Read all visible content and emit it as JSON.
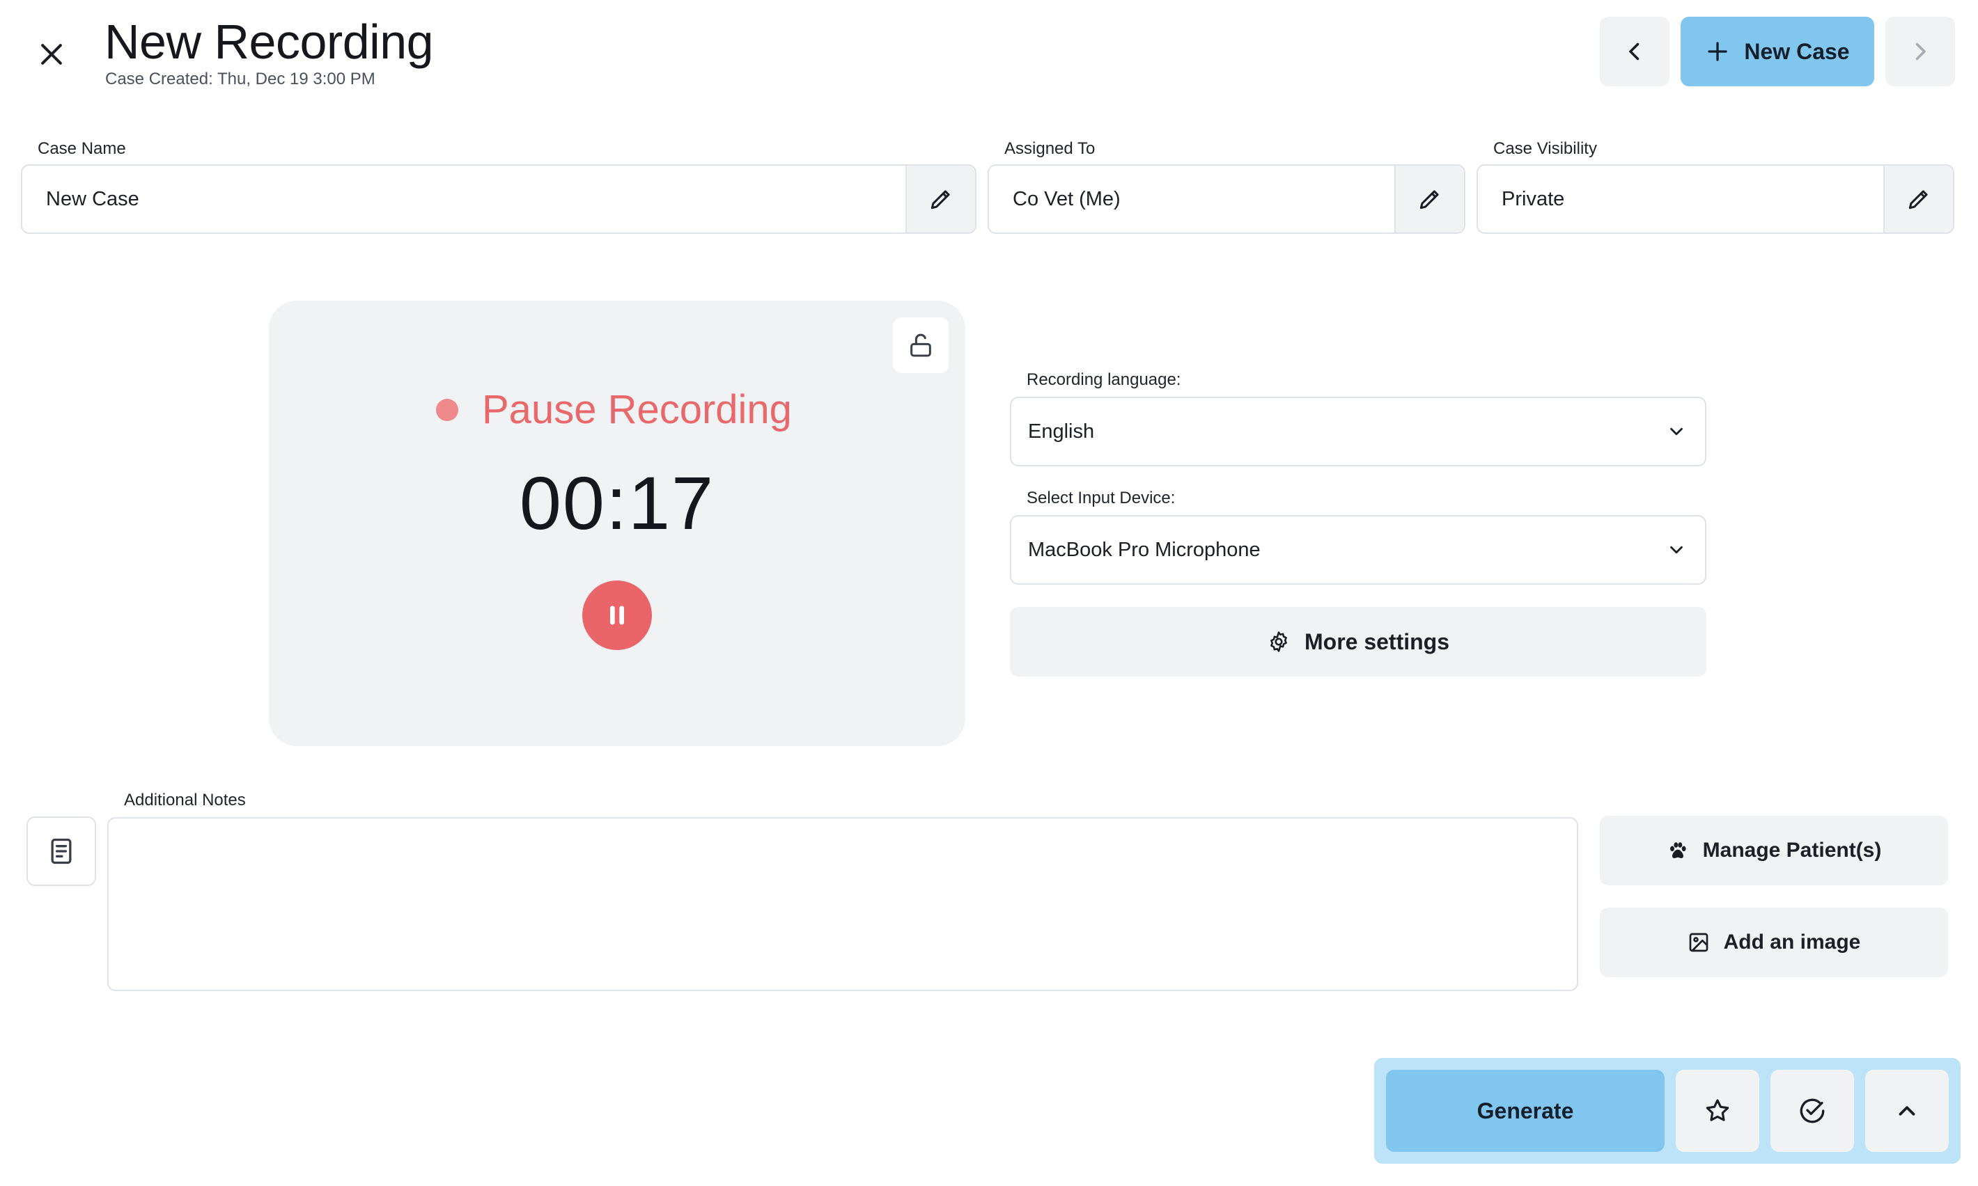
{
  "header": {
    "title": "New Recording",
    "subtitle": "Case Created: Thu, Dec 19 3:00 PM",
    "new_case_label": "New Case"
  },
  "fields": {
    "case_name": {
      "label": "Case Name",
      "value": "New Case"
    },
    "assigned_to": {
      "label": "Assigned To",
      "value": "Co Vet (Me)"
    },
    "visibility": {
      "label": "Case Visibility",
      "value": "Private"
    }
  },
  "recorder": {
    "status_label": "Pause Recording",
    "timer": "00:17",
    "status_color": "#e8686c"
  },
  "settings": {
    "language_label": "Recording language:",
    "language_value": "English",
    "device_label": "Select Input Device:",
    "device_value": "MacBook Pro Microphone",
    "more_settings_label": "More settings"
  },
  "notes": {
    "label": "Additional Notes",
    "value": ""
  },
  "side_actions": {
    "manage_patients_label": "Manage Patient(s)",
    "add_image_label": "Add an image"
  },
  "action_bar": {
    "generate_label": "Generate"
  },
  "colors": {
    "accent": "#80c6ef",
    "accent_bar": "#bde3f8",
    "record": "#e9656a",
    "surface": "#f1f2f4"
  },
  "icons": [
    "close-icon",
    "chevron-left-icon",
    "plus-icon",
    "chevron-right-icon",
    "pencil-icon",
    "unlock-icon",
    "pause-icon",
    "chevron-down-icon",
    "gear-icon",
    "notes-icon",
    "paw-icon",
    "image-icon",
    "star-icon",
    "check-circle-icon",
    "chevron-up-icon"
  ]
}
